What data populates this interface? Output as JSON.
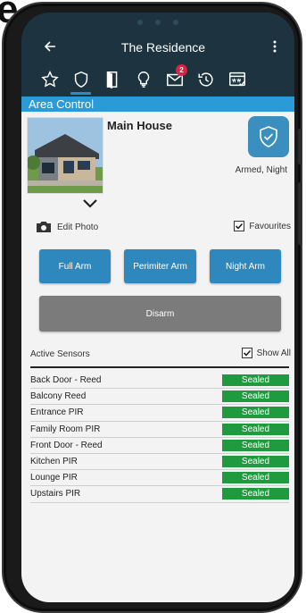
{
  "backdrop_text": "e",
  "app_bar": {
    "title": "The Residence",
    "back_icon": "arrow-left-icon",
    "menu_icon": "more-vertical-icon"
  },
  "tabs": [
    {
      "icon": "star-icon",
      "active": false
    },
    {
      "icon": "shield-icon",
      "active": true
    },
    {
      "icon": "door-icon",
      "active": false
    },
    {
      "icon": "lightbulb-icon",
      "active": false
    },
    {
      "icon": "mail-icon",
      "active": false,
      "badge": "2"
    },
    {
      "icon": "history-icon",
      "active": false
    },
    {
      "icon": "web-icon",
      "active": false
    }
  ],
  "section": {
    "title": "Area Control"
  },
  "area": {
    "name": "Main House",
    "status": "Armed, Night",
    "edit_photo_label": "Edit Photo",
    "favourites_label": "Favourites",
    "favourites_checked": true
  },
  "actions": {
    "full_arm": "Full Arm",
    "perimeter_arm": "Perimiter Arm",
    "night_arm": "Night Arm",
    "disarm": "Disarm"
  },
  "sensors": {
    "title": "Active Sensors",
    "show_all_label": "Show All",
    "show_all_checked": true,
    "items": [
      {
        "name": "Back Door - Reed",
        "state": "Sealed"
      },
      {
        "name": "Balcony Reed",
        "state": "Sealed"
      },
      {
        "name": "Entrance PIR",
        "state": "Sealed"
      },
      {
        "name": "Family Room PIR",
        "state": "Sealed"
      },
      {
        "name": "Front Door - Reed",
        "state": "Sealed"
      },
      {
        "name": "Kitchen PIR",
        "state": "Sealed"
      },
      {
        "name": "Lounge PIR",
        "state": "Sealed"
      },
      {
        "name": "Upstairs PIR",
        "state": "Sealed"
      }
    ]
  },
  "colors": {
    "app_bar_bg": "#1d3440",
    "accent": "#2a9bd6",
    "arm_button": "#2f88bd",
    "disarm_button": "#7b7b7b",
    "sealed": "#1f9a3f",
    "badge": "#e02040"
  }
}
